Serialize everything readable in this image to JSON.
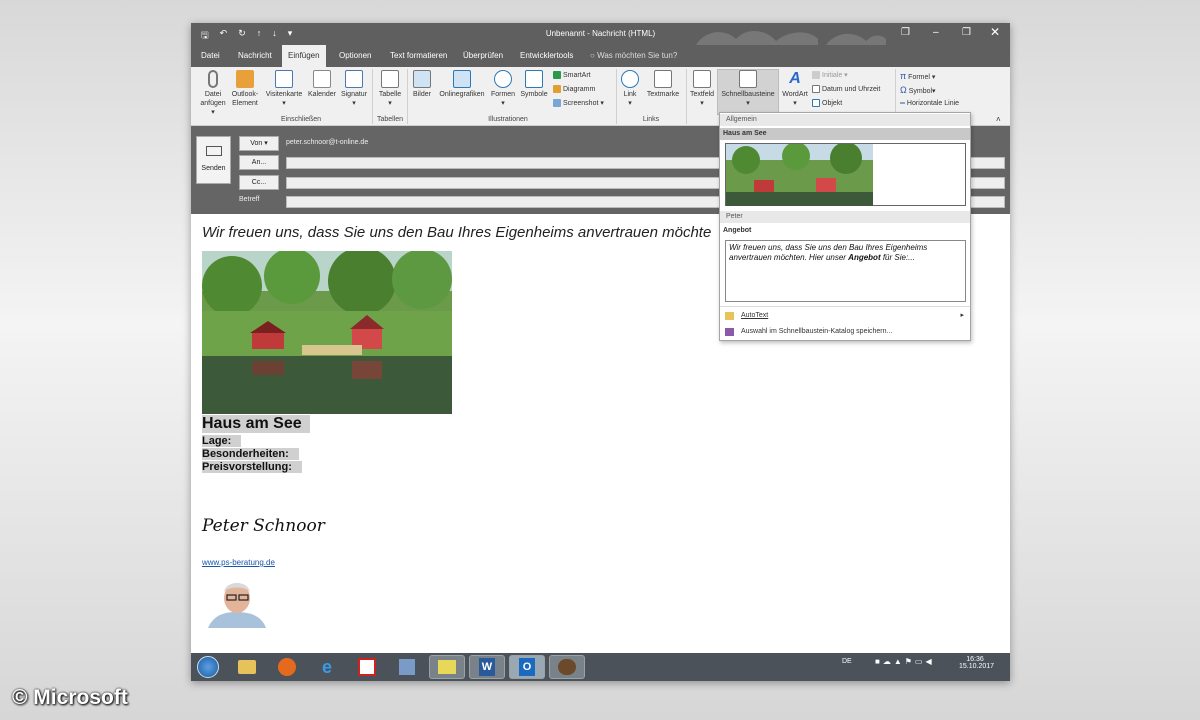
{
  "titlebar": {
    "title": "Unbenannt  -  Nachricht (HTML)"
  },
  "tabs": [
    "Datei",
    "Nachricht",
    "Einfügen",
    "Optionen",
    "Text formatieren",
    "Überprüfen",
    "Entwicklertools"
  ],
  "tell_me": "Was möchten Sie tun?",
  "ribbon": {
    "datei_anfuegen": "Datei\nanfügen",
    "outlook_element": "Outlook-\nElement",
    "visitenkarte": "Visitenkarte",
    "kalender": "Kalender",
    "signatur": "Signatur",
    "tabelle": "Tabelle",
    "bilder": "Bilder",
    "onlinegrafiken": "Onlinegrafiken",
    "formen": "Formen",
    "symbole": "Symbole",
    "smartart": "SmartArt",
    "diagramm": "Diagramm",
    "screenshot": "Screenshot",
    "link": "Link",
    "textmarke": "Textmarke",
    "textfeld": "Textfeld",
    "schnellbausteine": "Schnellbausteine",
    "wordart": "WordArt",
    "initiale": "Initiale",
    "datum_uhrzeit": "Datum und Uhrzeit",
    "objekt": "Objekt",
    "formel": "Formel",
    "symbol": "Symbol",
    "horizontale_linie": "Horizontale Linie",
    "groups": [
      "Einschließen",
      "Tabellen",
      "Illustrationen",
      "Links"
    ]
  },
  "header": {
    "send": "Senden",
    "von": "Von",
    "from_address": "peter.schnoor@t-online.de",
    "an": "An...",
    "cc": "Cc...",
    "betreff": "Betreff"
  },
  "body": {
    "intro": "Wir freuen uns, dass Sie uns den Bau Ihres Eigenheims anvertrauen möchte",
    "haus_title": "Haus am See",
    "lage": "Lage:",
    "besonderheiten": "Besonderheiten:",
    "preisvorstellung": "Preisvorstellung:",
    "signature": "Peter Schnoor",
    "link": "www.ps-beratung.de"
  },
  "dropdown": {
    "group1": "Allgemein",
    "entry1": "Haus am See",
    "group2": "Peter",
    "entry2": "Angebot",
    "preview_text_1": "Wir freuen uns, dass Sie uns den Bau Ihres Eigenheims anvertrauen möchten. Hier unser ",
    "preview_bold": "Angebot",
    "preview_text_2": " für Sie:...",
    "autotext": "AutoText",
    "save_item": "Auswahl im Schnellbaustein-Katalog speichern..."
  },
  "taskbar": {
    "lang": "DE",
    "time": "16:36",
    "date": "15.10.2017"
  },
  "watermark": "© Microsoft"
}
